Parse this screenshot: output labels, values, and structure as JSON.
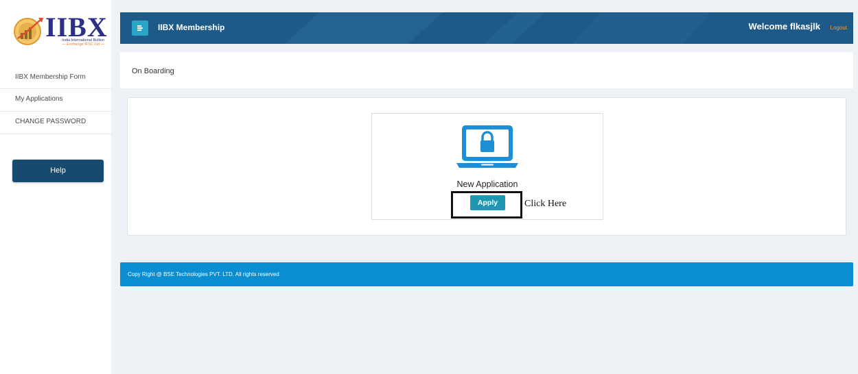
{
  "brand": {
    "logo_text": "IIBX",
    "logo_sub_line1": "India International Bullion",
    "logo_sub_line2": "— Exchange IFSC Ltd —"
  },
  "sidebar": {
    "items": [
      {
        "label": "IIBX Membership Form"
      },
      {
        "label": "My Applications"
      },
      {
        "label": "CHANGE PASSWORD"
      }
    ],
    "help_label": "Help"
  },
  "header": {
    "title": "IIBX Membership",
    "welcome": "Welcome flkasjlk",
    "logout": "Logout"
  },
  "breadcrumb": "On Boarding",
  "application_card": {
    "icon": "laptop-lock-icon",
    "label": "New Application",
    "apply_label": "Apply",
    "annotation": "Click Here"
  },
  "footer": {
    "text": "Copy Right @ BSE Technologies PVT. LTD. All rights reserved"
  },
  "colors": {
    "header_bg": "#1e5a87",
    "help_btn": "#164a6e",
    "apply_btn": "#1f97b3",
    "footer_bg": "#0b8dd1",
    "logout": "#f39a2d",
    "laptop": "#1e8fd6"
  }
}
